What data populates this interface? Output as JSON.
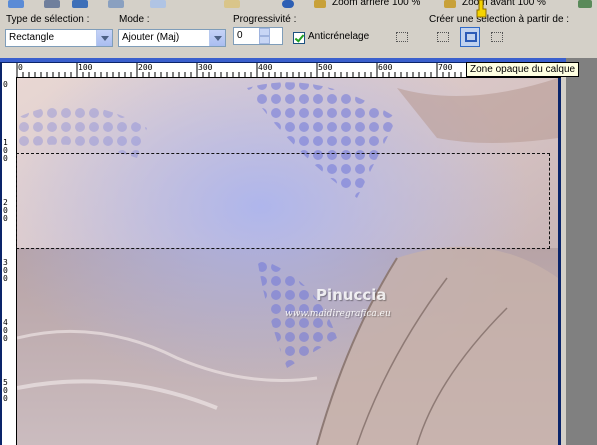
{
  "toolbar": {
    "items": [
      {
        "name": "save-icon"
      },
      {
        "name": "print-icon"
      },
      {
        "name": "undo-icon"
      },
      {
        "name": "redo-icon"
      },
      {
        "name": "copy-icon"
      },
      {
        "name": "paste-icon"
      },
      {
        "name": "info-icon"
      }
    ],
    "zoom_out_label": "Zoom arrière 100 %",
    "zoom_in_label": "Zoom avant 100 %"
  },
  "options": {
    "selection_type_label": "Type de sélection :",
    "selection_type_value": "Rectangle",
    "mode_label": "Mode :",
    "mode_value": "Ajouter (Maj)",
    "progressivity_label": "Progressivité :",
    "progressivity_value": "0",
    "antialias_label": "Anticrénelage",
    "antialias_checked": true,
    "create_from_label": "Créer une sélection à partir de :",
    "create_from_buttons": [
      "selection-from-vector-icon",
      "selection-from-opaque-layer-icon",
      "selection-from-mask-icon"
    ]
  },
  "tooltip": "Zone opaque du calque",
  "rulers": {
    "top_labels": [
      "0",
      "100",
      "200",
      "300",
      "400",
      "500",
      "600",
      "700"
    ],
    "left_labels": [
      "0",
      "1\n0\n0",
      "2\n0\n0",
      "3\n0\n0",
      "4\n0\n0",
      "5\n0\n0"
    ]
  },
  "watermark": {
    "name": "Pinuccia",
    "url": "www.maidiregrafica.eu"
  },
  "colors": {
    "selection_active": "#2c5bb7",
    "doc_border": "#3a5fcd",
    "tooltip_bg": "#ffffe1"
  }
}
